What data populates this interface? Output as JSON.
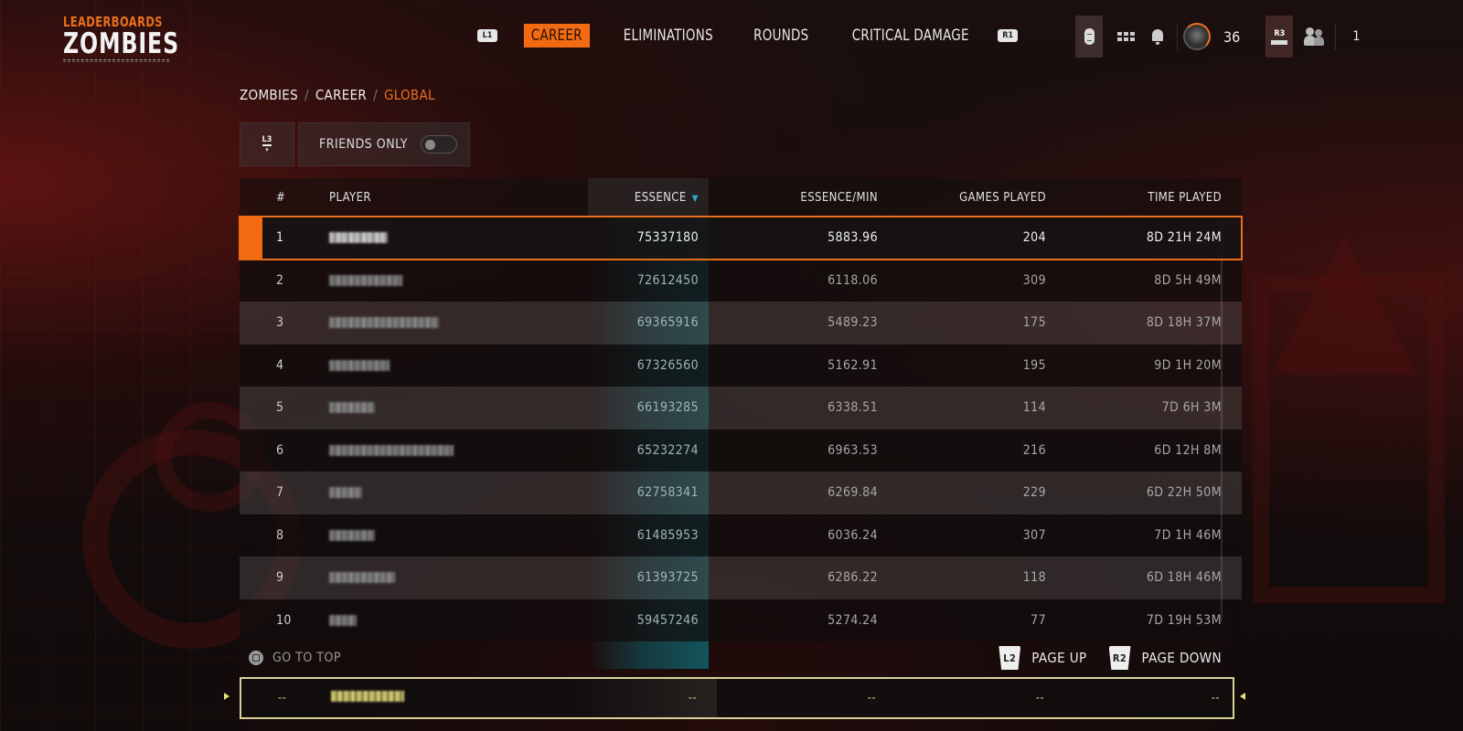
{
  "brand": {
    "subtitle": "LEADERBOARDS",
    "title": "ZOMBIES"
  },
  "tabs": {
    "left_bumper": "L1",
    "right_bumper": "R1",
    "items": [
      {
        "label": "CAREER",
        "active": true
      },
      {
        "label": "ELIMINATIONS",
        "active": false
      },
      {
        "label": "ROUNDS",
        "active": false
      },
      {
        "label": "CRITICAL DAMAGE",
        "active": false
      }
    ]
  },
  "top_right": {
    "player_level": "36",
    "r3_label": "R3",
    "friends_online": "1",
    "accent_color": "#f07020"
  },
  "breadcrumb": {
    "items": [
      "ZOMBIES",
      "CAREER"
    ],
    "current": "GLOBAL"
  },
  "filters": {
    "l3_label": "L3",
    "friends_only_label": "FRIENDS ONLY",
    "friends_only_on": false
  },
  "table": {
    "columns": {
      "rank": "#",
      "player": "PLAYER",
      "essence": "ESSENCE",
      "essence_per_min": "ESSENCE/MIN",
      "games_played": "GAMES PLAYED",
      "time_played": "TIME PLAYED"
    },
    "sort_column": "essence",
    "sort_direction": "descending",
    "rows": [
      {
        "rank": "1",
        "player": "[redacted]",
        "essence": "75337180",
        "essence_per_min": "5883.96",
        "games_played": "204",
        "time_played": "8D 21H 24M",
        "selected": true
      },
      {
        "rank": "2",
        "player": "[redacted]",
        "essence": "72612450",
        "essence_per_min": "6118.06",
        "games_played": "309",
        "time_played": "8D 5H 49M"
      },
      {
        "rank": "3",
        "player": "[redacted]",
        "essence": "69365916",
        "essence_per_min": "5489.23",
        "games_played": "175",
        "time_played": "8D 18H 37M"
      },
      {
        "rank": "4",
        "player": "[redacted]",
        "essence": "67326560",
        "essence_per_min": "5162.91",
        "games_played": "195",
        "time_played": "9D 1H 20M"
      },
      {
        "rank": "5",
        "player": "[redacted]",
        "essence": "66193285",
        "essence_per_min": "6338.51",
        "games_played": "114",
        "time_played": "7D 6H 3M"
      },
      {
        "rank": "6",
        "player": "[redacted]",
        "essence": "65232274",
        "essence_per_min": "6963.53",
        "games_played": "216",
        "time_played": "6D 12H 8M"
      },
      {
        "rank": "7",
        "player": "[redacted]",
        "essence": "62758341",
        "essence_per_min": "6269.84",
        "games_played": "229",
        "time_played": "6D 22H 50M"
      },
      {
        "rank": "8",
        "player": "[redacted]",
        "essence": "61485953",
        "essence_per_min": "6036.24",
        "games_played": "307",
        "time_played": "7D 1H 46M"
      },
      {
        "rank": "9",
        "player": "[redacted]",
        "essence": "61393725",
        "essence_per_min": "6286.22",
        "games_played": "118",
        "time_played": "6D 18H 46M"
      },
      {
        "rank": "10",
        "player": "[redacted]",
        "essence": "59457246",
        "essence_per_min": "5274.24",
        "games_played": "77",
        "time_played": "7D 19H 53M"
      }
    ],
    "player_row": {
      "rank": "--",
      "player": "[redacted]",
      "essence": "--",
      "essence_per_min": "--",
      "games_played": "--",
      "time_played": "--"
    }
  },
  "footer": {
    "go_to_top": "GO TO TOP",
    "page_up_button": "L2",
    "page_up": "PAGE UP",
    "page_down_button": "R2",
    "page_down": "PAGE DOWN"
  }
}
